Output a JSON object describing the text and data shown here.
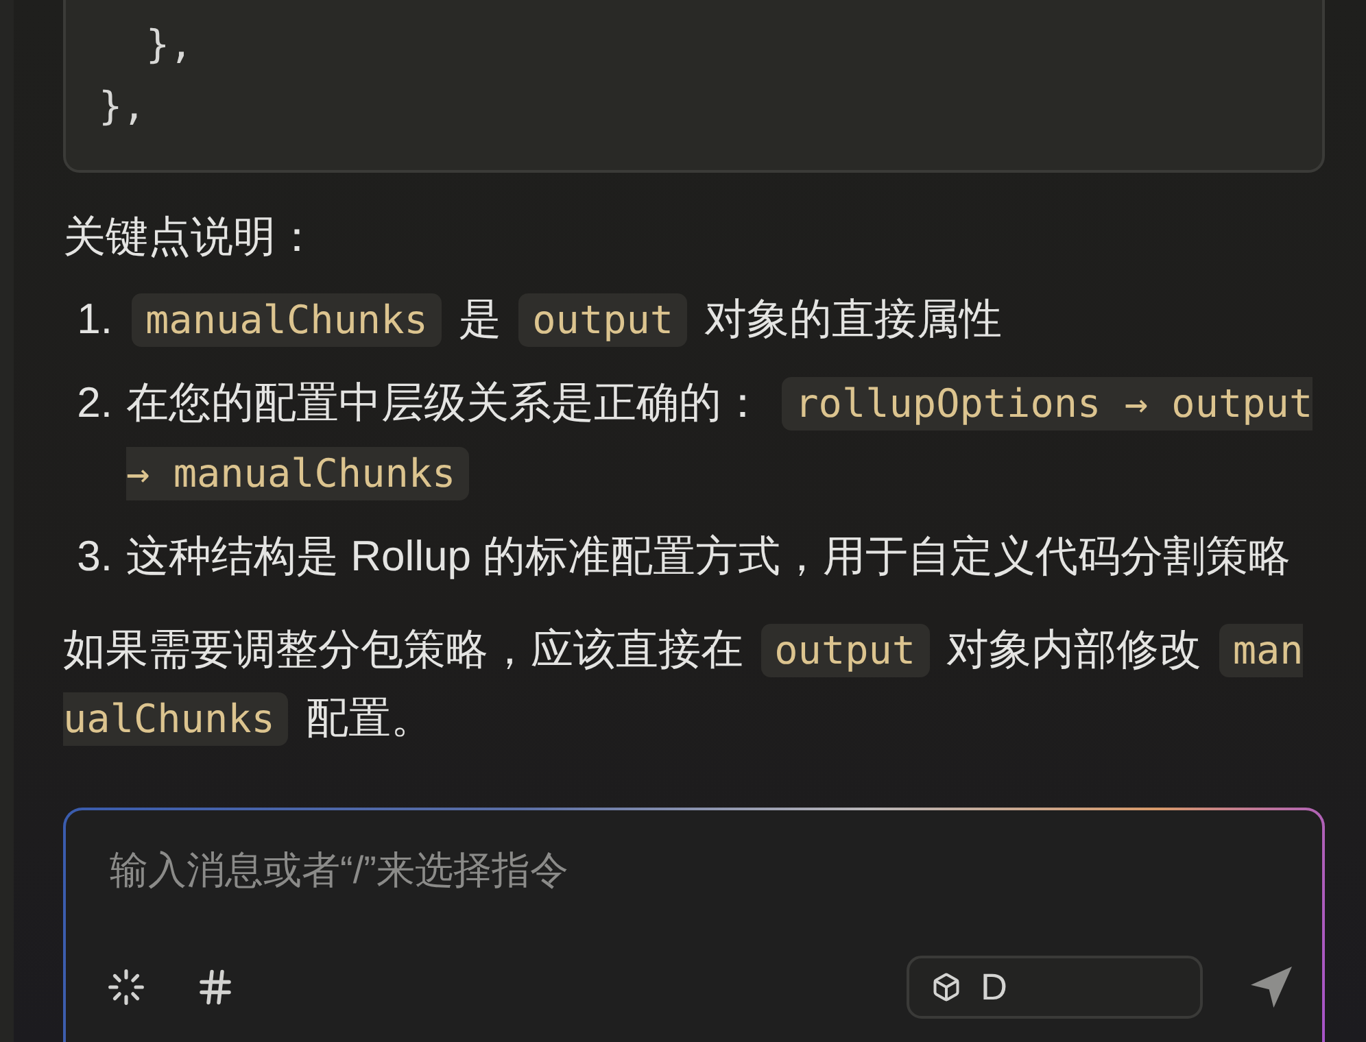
{
  "code_block": {
    "lines": [
      "  },",
      "},"
    ]
  },
  "heading": "关键点说明：",
  "points": [
    {
      "number": "1.",
      "segments": [
        {
          "kind": "code",
          "text": "manualChunks"
        },
        {
          "kind": "text",
          "text": " 是 "
        },
        {
          "kind": "code",
          "text": "output"
        },
        {
          "kind": "text",
          "text": " 对象的直接属性"
        }
      ]
    },
    {
      "number": "2.",
      "segments": [
        {
          "kind": "text",
          "text": "在您的配置中层级关系是正确的： "
        },
        {
          "kind": "code",
          "text": "rollupOptions → output → manualChunks"
        }
      ]
    },
    {
      "number": "3.",
      "segments": [
        {
          "kind": "text",
          "text": "这种结构是 Rollup 的标准配置方式，用于自定义代码分割策略"
        }
      ]
    }
  ],
  "paragraph": {
    "segments": [
      {
        "kind": "text",
        "text": "如果需要调整分包策略，应该直接在 "
      },
      {
        "kind": "code",
        "text": "output"
      },
      {
        "kind": "text",
        "text": " 对象内部修改 "
      },
      {
        "kind": "code",
        "text": "manualChunks"
      },
      {
        "kind": "text",
        "text": " 配置。"
      }
    ]
  },
  "composer": {
    "placeholder": "输入消息或者“/”来选择指令",
    "model_button": {
      "label": "D"
    }
  }
}
